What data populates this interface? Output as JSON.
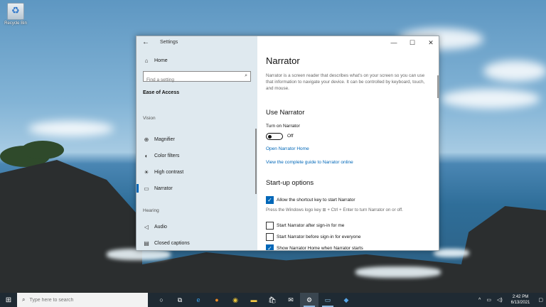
{
  "desktop": {
    "recycle_bin_label": "Recycle Bin"
  },
  "window": {
    "title": "Settings",
    "controls": {
      "minimize": "—",
      "maximize": "☐",
      "close": "✕"
    }
  },
  "nav": {
    "home_label": "Home",
    "search_placeholder": "Find a setting",
    "section_title": "Ease of Access",
    "group_vision": "Vision",
    "group_hearing": "Hearing",
    "items": [
      {
        "label": "Magnifier",
        "icon": "magnifier-icon"
      },
      {
        "label": "Color filters",
        "icon": "color-filters-icon"
      },
      {
        "label": "High contrast",
        "icon": "high-contrast-icon"
      },
      {
        "label": "Narrator",
        "icon": "narrator-icon",
        "active": true
      },
      {
        "label": "Audio",
        "icon": "audio-icon"
      },
      {
        "label": "Closed captions",
        "icon": "closed-captions-icon"
      }
    ]
  },
  "content": {
    "title": "Narrator",
    "description": "Narrator is a screen reader that describes what's on your screen so you can use that information to navigate your device. It can be controlled by keyboard, touch, and mouse.",
    "use_narrator_heading": "Use Narrator",
    "turn_on_label": "Turn on Narrator",
    "toggle_state": "Off",
    "link_home": "Open Narrator Home",
    "link_guide": "View the complete guide to Narrator online",
    "startup_heading": "Start-up options",
    "options": [
      {
        "label": "Allow the shortcut key to start Narrator",
        "checked": true
      },
      {
        "label": "Start Narrator after sign-in for me",
        "checked": false
      },
      {
        "label": "Start Narrator before sign-in for everyone",
        "checked": false
      },
      {
        "label": "Show Narrator Home when Narrator starts",
        "checked": true
      }
    ],
    "shortcut_hint": "Press the Windows logo key ⊞ + Ctrl + Enter to turn Narrator on or off."
  },
  "taskbar": {
    "search_placeholder": "Type here to search",
    "apps": [
      {
        "name": "cortana-icon",
        "glyph": "○"
      },
      {
        "name": "task-view-icon",
        "glyph": "⧉"
      },
      {
        "name": "edge-icon",
        "glyph": "e"
      },
      {
        "name": "firefox-icon",
        "glyph": "●"
      },
      {
        "name": "chrome-icon",
        "glyph": "◉"
      },
      {
        "name": "file-explorer-icon",
        "glyph": "▬"
      },
      {
        "name": "store-icon",
        "glyph": "🛍"
      },
      {
        "name": "mail-icon",
        "glyph": "✉"
      },
      {
        "name": "settings-icon",
        "glyph": "⚙"
      },
      {
        "name": "remote-desktop-icon",
        "glyph": "▭"
      },
      {
        "name": "visual-studio-icon",
        "glyph": "◆"
      }
    ],
    "time": "2:42 PM",
    "date": "6/13/2021"
  }
}
